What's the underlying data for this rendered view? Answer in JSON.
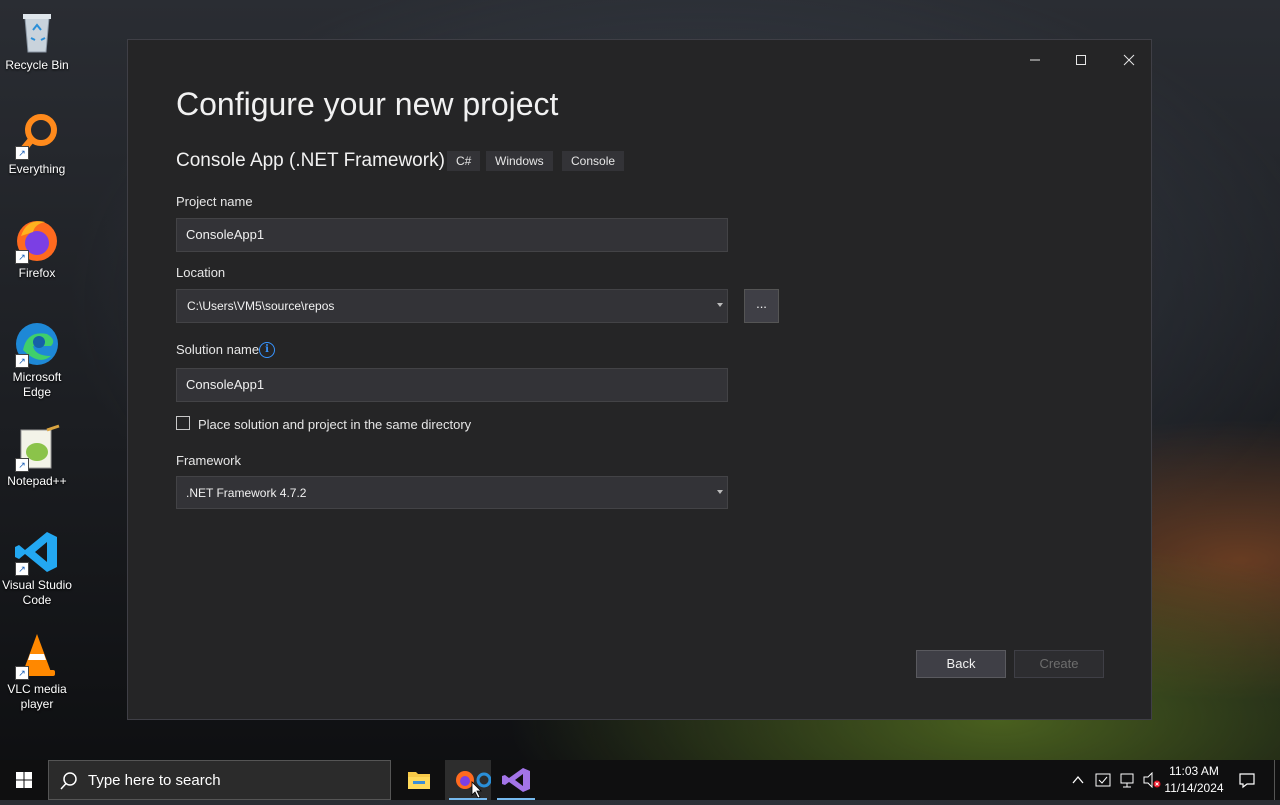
{
  "desktop": {
    "icons": [
      {
        "label": "Recycle Bin"
      },
      {
        "label": "Everything"
      },
      {
        "label": "Firefox"
      },
      {
        "label": "Microsoft Edge"
      },
      {
        "label": "Notepad++"
      },
      {
        "label": "Visual Studio Code"
      },
      {
        "label": "VLC media player"
      }
    ]
  },
  "dialog": {
    "title": "Configure your new project",
    "template_name": "Console App (.NET Framework)",
    "tags": [
      "C#",
      "Windows",
      "Console"
    ],
    "project_name": {
      "label": "Project name",
      "value": "ConsoleApp1"
    },
    "location": {
      "label": "Location",
      "value": "C:\\Users\\VM5\\source\\repos",
      "browse_label": "..."
    },
    "solution_name": {
      "label": "Solution name",
      "value": "ConsoleApp1",
      "info_icon": "info-icon"
    },
    "same_directory": {
      "label": "Place solution and project in the same directory",
      "checked": false
    },
    "framework": {
      "label": "Framework",
      "value": ".NET Framework 4.7.2"
    },
    "buttons": {
      "back": "Back",
      "create": "Create"
    }
  },
  "taskbar": {
    "search_placeholder": "Type here to search",
    "apps": [
      "file-explorer-icon",
      "firefox-edge-icon",
      "visual-studio-icon"
    ],
    "clock": {
      "time": "11:03 AM",
      "date": "11/14/2024"
    }
  },
  "colors": {
    "dialog_bg": "#252526",
    "input_bg": "#333337",
    "accent": "#3794ff",
    "taskbar_bg": "#0f0f10"
  }
}
